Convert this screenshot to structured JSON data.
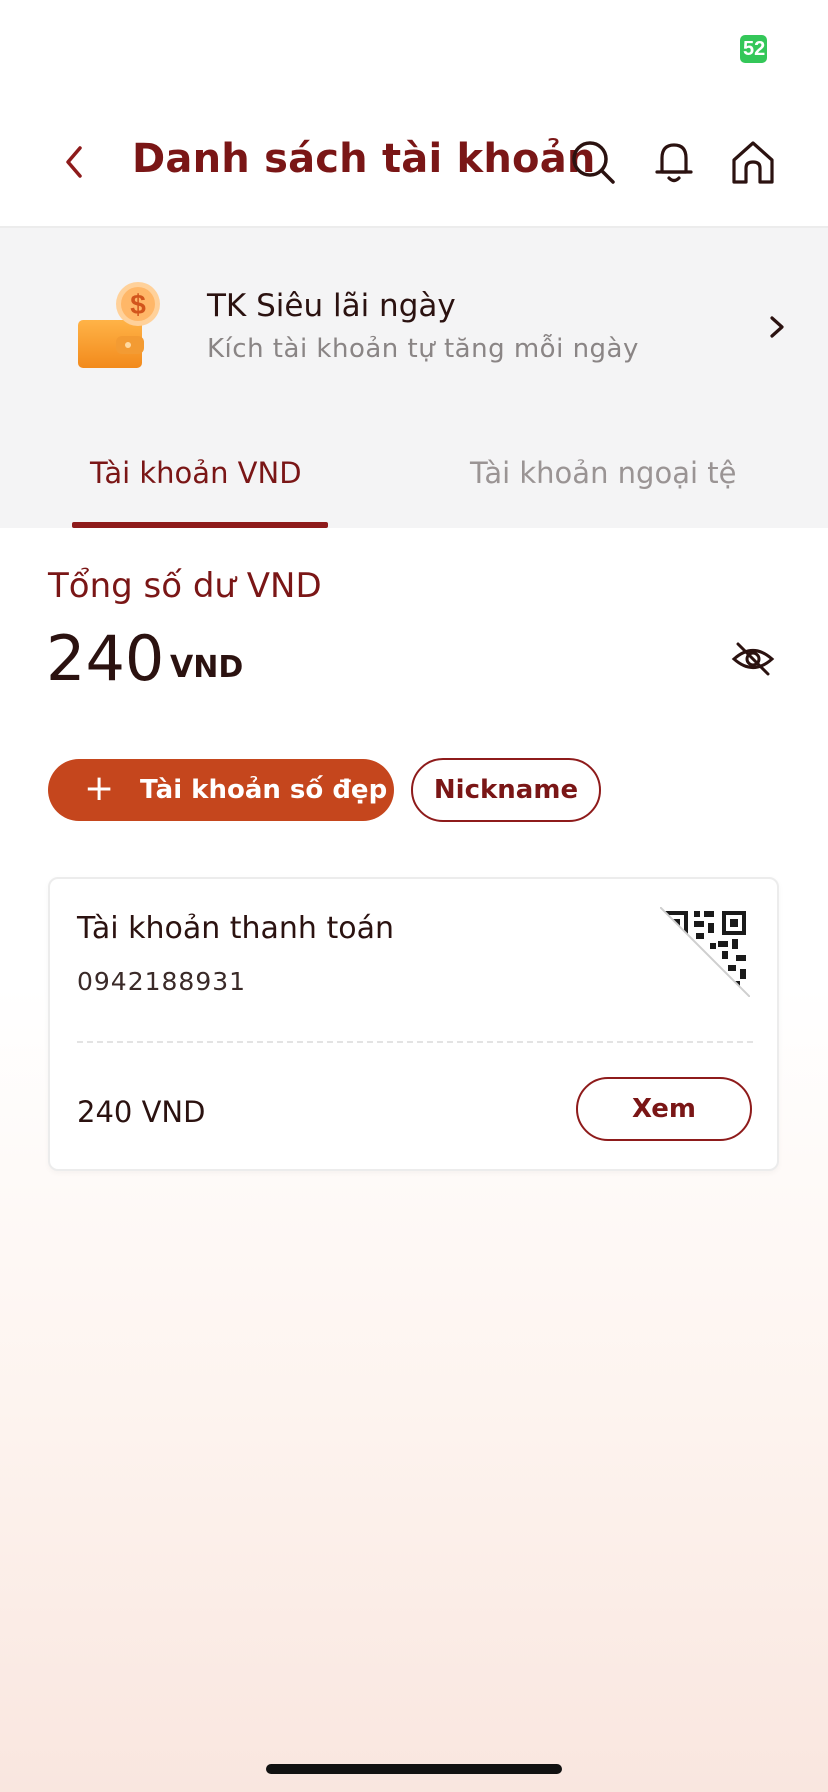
{
  "status_bar": {
    "battery": "52"
  },
  "header": {
    "title": "Danh sách tài khoản"
  },
  "promo": {
    "title": "TK Siêu lãi ngày",
    "subtitle": "Kích tài khoản tự tăng mỗi ngày"
  },
  "tabs": [
    {
      "label": "Tài khoản VND",
      "active": true
    },
    {
      "label": "Tài khoản ngoại tệ",
      "active": false
    }
  ],
  "summary": {
    "label": "Tổng số dư VND",
    "amount": "240",
    "currency": "VND"
  },
  "actions": {
    "add_label": "Tài khoản số đẹp",
    "add_icon": "+",
    "nickname_label": "Nickname"
  },
  "account": {
    "name": "Tài khoản thanh toán",
    "number": "0942188931",
    "balance": "240 VND",
    "view_label": "Xem"
  },
  "colors": {
    "brand": "#7a1616",
    "accent": "#c5461d",
    "battery": "#34c759"
  },
  "icons": [
    "back-icon",
    "search-icon",
    "bell-icon",
    "home-icon",
    "wallet-coin-icon",
    "chevron-right-icon",
    "eye-slash-icon",
    "plus-icon",
    "qr-code-icon"
  ]
}
